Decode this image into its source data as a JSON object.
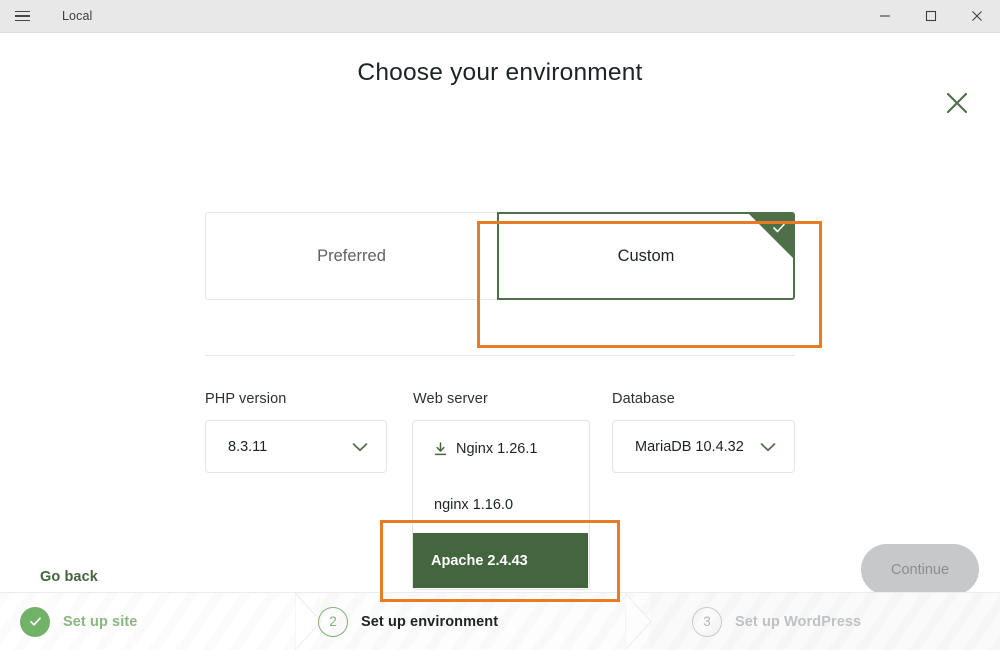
{
  "window": {
    "app_title": "Local",
    "menu_icon": "hamburger-icon",
    "minimize_icon": "minimize-icon",
    "maximize_icon": "maximize-icon",
    "close_icon": "close-icon"
  },
  "modal": {
    "title": "Choose your environment",
    "close_icon": "close-icon"
  },
  "tabs": [
    {
      "label": "Preferred",
      "selected": false
    },
    {
      "label": "Custom",
      "selected": true,
      "check_icon": "check-icon"
    }
  ],
  "fields": {
    "php": {
      "label": "PHP version",
      "value": "8.3.11",
      "chevron_icon": "chevron-down-icon"
    },
    "web_server": {
      "label": "Web server",
      "options": [
        {
          "label": "Nginx 1.26.1",
          "icon": "download-icon",
          "needs_download": true,
          "selected": false
        },
        {
          "label": "nginx 1.16.0",
          "icon": "",
          "needs_download": false,
          "selected": false
        },
        {
          "label": "Apache 2.4.43",
          "icon": "",
          "needs_download": false,
          "selected": true
        }
      ]
    },
    "database": {
      "label": "Database",
      "value": "MariaDB 10.4.32",
      "chevron_icon": "chevron-down-icon"
    }
  },
  "actions": {
    "go_back": "Go back",
    "continue": "Continue",
    "continue_disabled": true
  },
  "steps": [
    {
      "number": "1",
      "label": "Set up site",
      "state": "done",
      "icon": "check-icon"
    },
    {
      "number": "2",
      "label": "Set up environment",
      "state": "active",
      "icon": ""
    },
    {
      "number": "3",
      "label": "Set up WordPress",
      "state": "todo",
      "icon": ""
    }
  ],
  "colors": {
    "accent_green": "#44663e",
    "highlight_orange": "#e87c25",
    "done_green": "#72b168",
    "disabled_gray": "#c7c8ca"
  }
}
